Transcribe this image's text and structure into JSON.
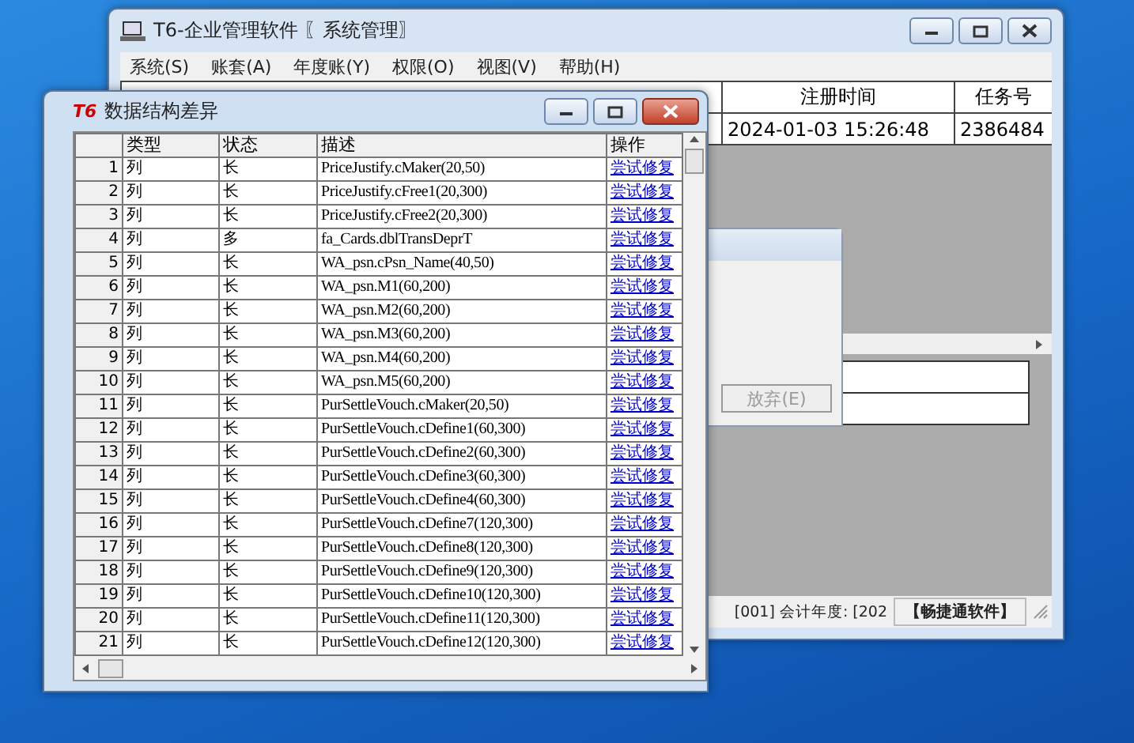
{
  "main_window": {
    "title": "T6-企业管理软件 〖系统管理〗",
    "menu": [
      "系统(S)",
      "账套(A)",
      "年度账(Y)",
      "权限(O)",
      "视图(V)",
      "帮助(H)"
    ],
    "task_table": {
      "columns": [
        "注册时间",
        "任务号"
      ],
      "rows": [
        [
          "2024-01-03 15:26:48",
          "2386484"
        ]
      ]
    },
    "hidden_dialog": {
      "button": {
        "label": "放弃(E)",
        "disabled": true
      }
    },
    "status_bar": [
      "[001] 会计年度: [202",
      "【畅捷通软件】"
    ]
  },
  "dialog": {
    "logo": "T6",
    "title": "数据结构差异",
    "table": {
      "columns": [
        "类型",
        "状态",
        "描述",
        "操作"
      ],
      "rows": [
        {
          "index": "1",
          "type": "列",
          "state": "长",
          "description": "PriceJustify.cMaker(20,50)",
          "action": "尝试修复"
        },
        {
          "index": "2",
          "type": "列",
          "state": "长",
          "description": "PriceJustify.cFree1(20,300)",
          "action": "尝试修复"
        },
        {
          "index": "3",
          "type": "列",
          "state": "长",
          "description": "PriceJustify.cFree2(20,300)",
          "action": "尝试修复"
        },
        {
          "index": "4",
          "type": "列",
          "state": "多",
          "description": "fa_Cards.dblTransDeprT",
          "action": "尝试修复"
        },
        {
          "index": "5",
          "type": "列",
          "state": "长",
          "description": "WA_psn.cPsn_Name(40,50)",
          "action": "尝试修复"
        },
        {
          "index": "6",
          "type": "列",
          "state": "长",
          "description": "WA_psn.M1(60,200)",
          "action": "尝试修复"
        },
        {
          "index": "7",
          "type": "列",
          "state": "长",
          "description": "WA_psn.M2(60,200)",
          "action": "尝试修复"
        },
        {
          "index": "8",
          "type": "列",
          "state": "长",
          "description": "WA_psn.M3(60,200)",
          "action": "尝试修复"
        },
        {
          "index": "9",
          "type": "列",
          "state": "长",
          "description": "WA_psn.M4(60,200)",
          "action": "尝试修复"
        },
        {
          "index": "10",
          "type": "列",
          "state": "长",
          "description": "WA_psn.M5(60,200)",
          "action": "尝试修复"
        },
        {
          "index": "11",
          "type": "列",
          "state": "长",
          "description": "PurSettleVouch.cMaker(20,50)",
          "action": "尝试修复"
        },
        {
          "index": "12",
          "type": "列",
          "state": "长",
          "description": "PurSettleVouch.cDefine1(60,300)",
          "action": "尝试修复"
        },
        {
          "index": "13",
          "type": "列",
          "state": "长",
          "description": "PurSettleVouch.cDefine2(60,300)",
          "action": "尝试修复"
        },
        {
          "index": "14",
          "type": "列",
          "state": "长",
          "description": "PurSettleVouch.cDefine3(60,300)",
          "action": "尝试修复"
        },
        {
          "index": "15",
          "type": "列",
          "state": "长",
          "description": "PurSettleVouch.cDefine4(60,300)",
          "action": "尝试修复"
        },
        {
          "index": "16",
          "type": "列",
          "state": "长",
          "description": "PurSettleVouch.cDefine7(120,300)",
          "action": "尝试修复"
        },
        {
          "index": "17",
          "type": "列",
          "state": "长",
          "description": "PurSettleVouch.cDefine8(120,300)",
          "action": "尝试修复"
        },
        {
          "index": "18",
          "type": "列",
          "state": "长",
          "description": "PurSettleVouch.cDefine9(120,300)",
          "action": "尝试修复"
        },
        {
          "index": "19",
          "type": "列",
          "state": "长",
          "description": "PurSettleVouch.cDefine10(120,300)",
          "action": "尝试修复"
        },
        {
          "index": "20",
          "type": "列",
          "state": "长",
          "description": "PurSettleVouch.cDefine11(120,300)",
          "action": "尝试修复"
        },
        {
          "index": "21",
          "type": "列",
          "state": "长",
          "description": "PurSettleVouch.cDefine12(120,300)",
          "action": "尝试修复"
        }
      ]
    }
  }
}
